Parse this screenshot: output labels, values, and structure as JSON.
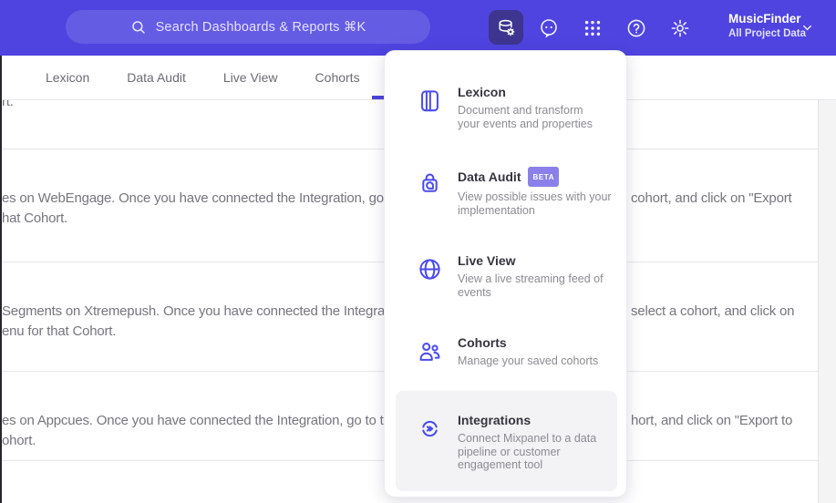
{
  "topbar": {
    "search_placeholder": "Search Dashboards & Reports ⌘K",
    "project_name": "MusicFinder",
    "project_scope": "All Project Data",
    "icons": [
      "search-icon",
      "data-management-icon",
      "feedback-icon",
      "apps-grid-icon",
      "help-icon",
      "settings-icon",
      "chevron-down-icon"
    ]
  },
  "nav": {
    "tabs": [
      "Lexicon",
      "Data Audit",
      "Live View",
      "Cohorts"
    ]
  },
  "menu": {
    "items": [
      {
        "label": "Lexicon",
        "icon": "book-icon",
        "description": "Document and transform\nyour events and properties"
      },
      {
        "label": "Data Audit",
        "icon": "audit-lock-icon",
        "badge": "BETA",
        "description": "View possible issues with your\nimplementation"
      },
      {
        "label": "Live View",
        "icon": "globe-icon",
        "description": "View a live streaming feed of\nevents"
      },
      {
        "label": "Cohorts",
        "icon": "users-icon",
        "description": "Manage your saved cohorts"
      },
      {
        "label": "Integrations",
        "icon": "sync-arrows-icon",
        "description": "Connect Mixpanel to a data\npipeline or customer\nengagement tool",
        "highlighted": true
      }
    ]
  },
  "content": {
    "partial_row": "rt.",
    "rows": [
      {
        "left": "es on WebEngage. Once you have connected the Integration, go to the\nhat Cohort.",
        "right": "cohort, and click on \"Export"
      },
      {
        "left": "Segments on Xtremepush. Once you have connected the Integration,\nenu for that Cohort.",
        "right": "select a cohort, and click on"
      },
      {
        "left": "es on Appcues. Once you have connected the Integration, go to the M\nohort.",
        "right": "hort, and click on \"Export to"
      }
    ]
  },
  "colors": {
    "topbar_bg": "#4f44e0",
    "active_tile_bg": "#3d3590",
    "tab_indicator": "#4c44dd",
    "menu_icon_blue": "#4b4bed",
    "badge_bg": "#8b80ea",
    "hover_row_bg": "#f3f3f5",
    "body_text": "#75757e"
  }
}
